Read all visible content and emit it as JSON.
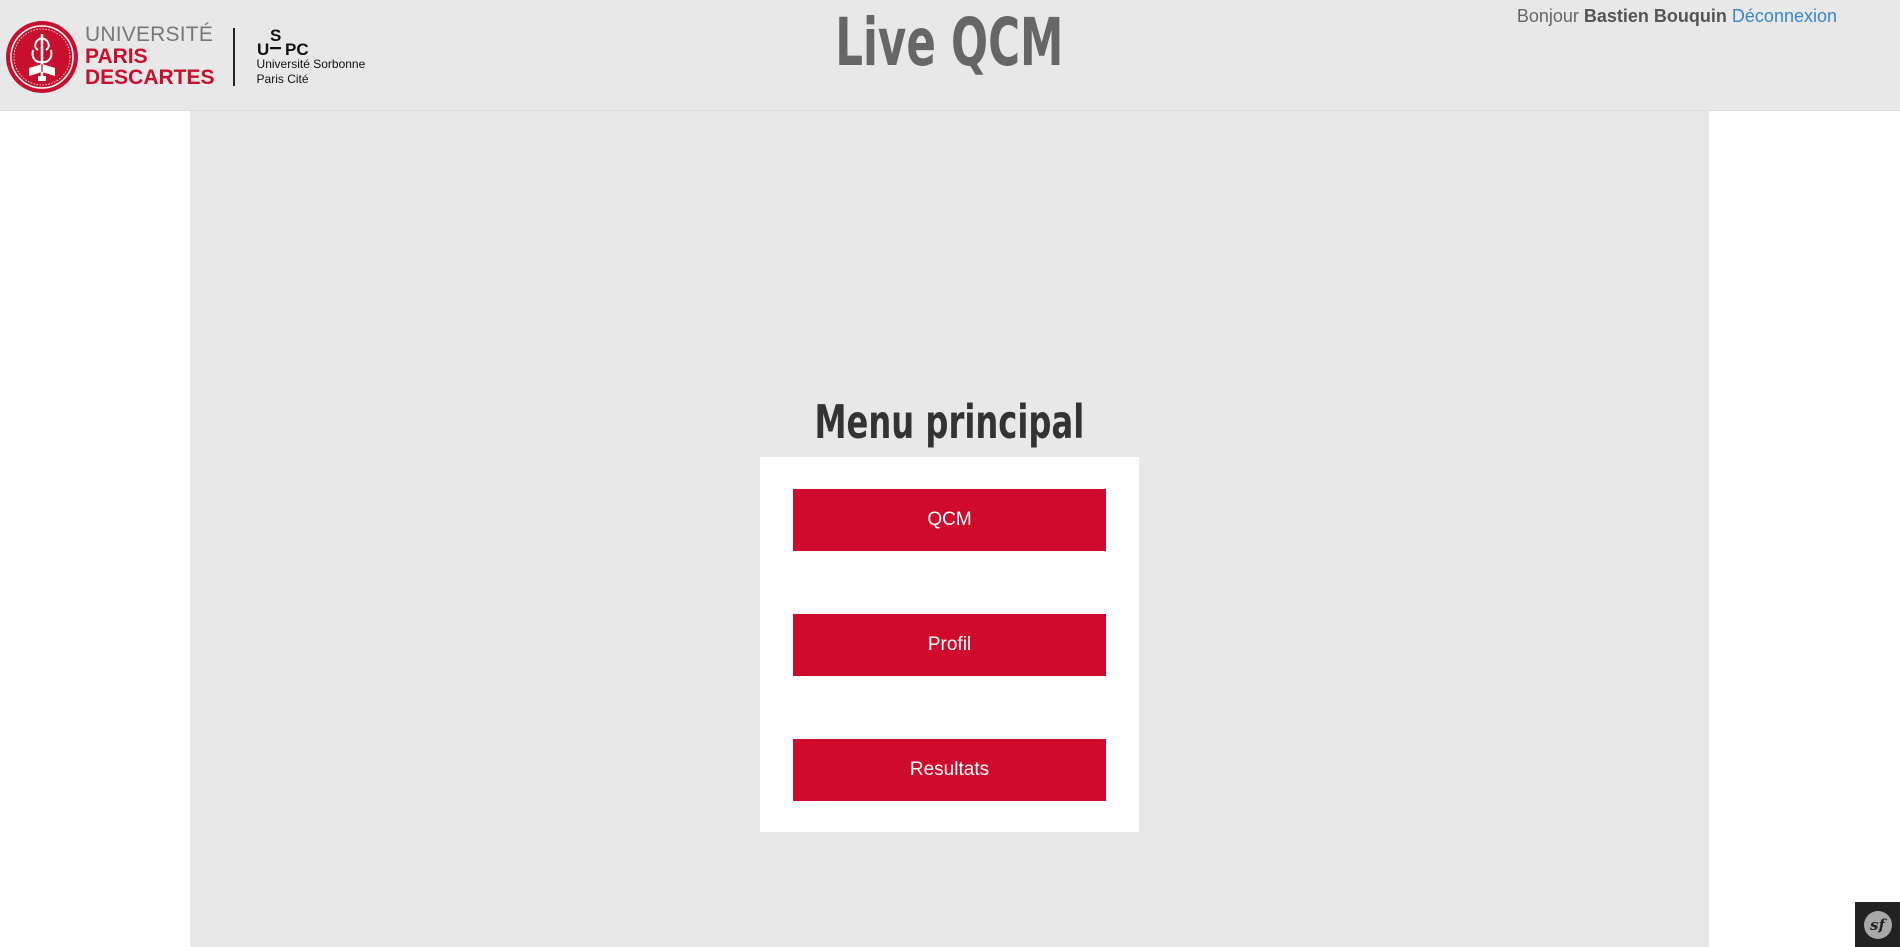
{
  "header": {
    "logo": {
      "line1": "UNIVERSITÉ",
      "line2": "PARIS",
      "line3": "DESCARTES",
      "uspc_sub1": "Université Sorbonne",
      "uspc_sub2": "Paris Cité",
      "uspc_mark": "USPC"
    },
    "title": "Live QCM",
    "greeting": "Bonjour",
    "username": "Bastien Bouquin",
    "logout_label": "Déconnexion"
  },
  "main": {
    "menu_title": "Menu principal",
    "buttons": [
      {
        "label": "QCM"
      },
      {
        "label": "Profil"
      },
      {
        "label": "Resultats"
      }
    ]
  },
  "toolbar": {
    "symfony_icon": "symfony-icon",
    "symfony_glyph": "sf"
  },
  "colors": {
    "accent": "#cf0a2c",
    "header_bg": "#e8e8e8",
    "link": "#3a87c9"
  }
}
